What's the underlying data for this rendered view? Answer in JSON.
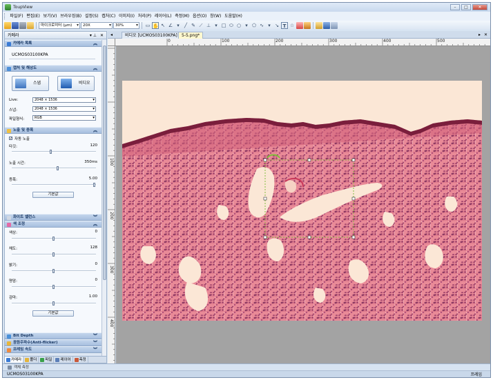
{
  "window": {
    "title": "ToupView"
  },
  "menu": [
    "파일(F)",
    "편집(E)",
    "보기(V)",
    "브라우징(B)",
    "설정(S)",
    "캡처(C)",
    "이미지(I)",
    "처리(P)",
    "레이어(L)",
    "측정(M)",
    "옵션(O)",
    "창(W)",
    "도움말(H)"
  ],
  "toolbar": {
    "unit_select": "마이크로미터 (μm)",
    "objective_select": "20X",
    "zoom_select": "30%"
  },
  "camera_panel": {
    "title": "카메라",
    "pin_icon": "pin-icon",
    "close_icon": "close-icon",
    "sections": {
      "camera_list": {
        "title": "카메라 목록",
        "camera_name": "UCMOS03100KPA"
      },
      "capture": {
        "title": "캡처 및 해상도",
        "snap_label": "스냅",
        "video_label": "비디오",
        "live_label": "Live:",
        "live_value": "2048 × 1536",
        "snap_res_label": "스냅:",
        "snap_res_value": "2048 × 1536",
        "format_label": "파일형식:",
        "format_value": "RGB"
      },
      "exposure": {
        "title": "노출 및 증폭",
        "auto_label": "자동 노출",
        "auto_checked": true,
        "target_label": "타깃:",
        "target_value": "120",
        "target_level": 0.47,
        "time_label": "노출 시간:",
        "time_value": "350ms",
        "time_level": 0.55,
        "gain_label": "증폭:",
        "gain_value": "5.00",
        "gain_level": 1.0,
        "default_label": "기본값"
      },
      "white_balance": {
        "title": "화이트 밸런스"
      },
      "color": {
        "title": "색 조정",
        "hue_label": "색상:",
        "hue_value": "0",
        "hue_level": 0.5,
        "saturation_label": "채도:",
        "saturation_value": "128",
        "saturation_level": 0.5,
        "brightness_label": "밝기:",
        "brightness_value": "0",
        "brightness_level": 0.5,
        "contrast_label": "명암:",
        "contrast_value": "0",
        "contrast_level": 0.5,
        "gamma_label": "감마:",
        "gamma_value": "1.00",
        "gamma_level": 0.5,
        "default_label": "기본값"
      },
      "bit_depth": {
        "title": "Bit Depth"
      },
      "anti_flicker": {
        "title": "광원주파수(Anti-flicker)"
      },
      "frame_rate": {
        "title": "프레임 속도"
      }
    },
    "bottom_tabs": [
      "카메라",
      "폴더",
      "파일",
      "레이어",
      "측정"
    ]
  },
  "documents": {
    "tabs": [
      "비디오 [UCMOS03100KPA]",
      "5-5.png*"
    ],
    "active": 1
  },
  "ruler": {
    "h_labels": [
      "0",
      "100",
      "200",
      "300",
      "400",
      "500"
    ],
    "v_labels": [
      "100",
      "200",
      "300",
      "400"
    ]
  },
  "status": {
    "sub_tab": "객체 측정",
    "camera": "UCMOS03100KPA",
    "right": "프레임"
  },
  "colors": {
    "tissue_bg": "#fbe7d6",
    "tissue_pink": "#e7808f",
    "edge_dark": "#7a1e3c",
    "selection": "#7fbf3a"
  }
}
